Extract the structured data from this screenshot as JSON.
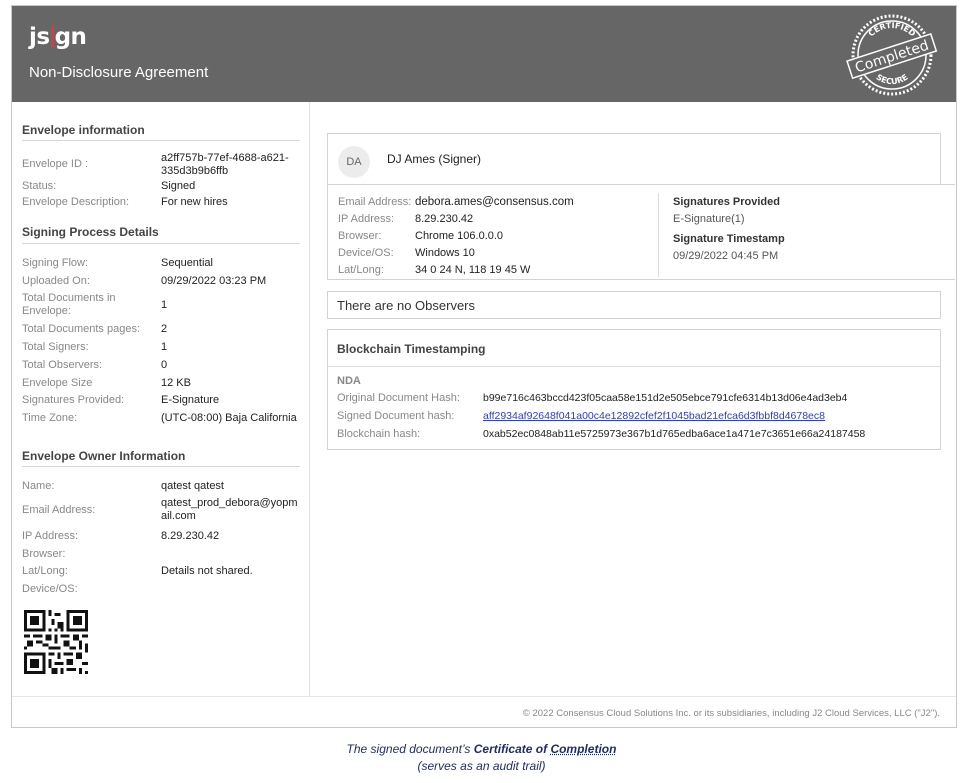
{
  "header": {
    "logo_left": "js",
    "logo_right": "gn",
    "document_title": "Non-Disclosure Agreement",
    "seal_top": "CERTIFIED",
    "seal_middle": "Completed",
    "seal_bottom": "SECURE"
  },
  "envelope_info": {
    "title": "Envelope information",
    "rows": [
      {
        "label": "Envelope ID :",
        "value": "a2ff757b-77ef-4688-a621-335d3b9b6ffb"
      },
      {
        "label": "Status:",
        "value": "Signed"
      },
      {
        "label": "Envelope Description:",
        "value": "For new hires"
      }
    ]
  },
  "signing_process": {
    "title": "Signing Process Details",
    "rows": [
      {
        "label": "Signing Flow:",
        "value": "Sequential"
      },
      {
        "label": "Uploaded On:",
        "value": "09/29/2022 03:23 PM"
      },
      {
        "label": "Total Documents in Envelope:",
        "value": "1"
      },
      {
        "label": "Total Documents pages:",
        "value": "2"
      },
      {
        "label": "Total Signers:",
        "value": "1"
      },
      {
        "label": "Total Observers:",
        "value": "0"
      },
      {
        "label": "Envelope Size",
        "value": "12 KB"
      },
      {
        "label": "Signatures Provided:",
        "value": "E-Signature"
      },
      {
        "label": "Time Zone:",
        "value": "(UTC-08:00) Baja California"
      }
    ]
  },
  "owner_info": {
    "title": "Envelope Owner Information",
    "rows": [
      {
        "label": "Name:",
        "value": "qatest qatest"
      },
      {
        "label": "Email Address:",
        "value": "qatest_prod_debora@yopmail.com"
      },
      {
        "label": "IP Address:",
        "value": "8.29.230.42"
      },
      {
        "label": "Browser:",
        "value": ""
      },
      {
        "label": "Lat/Long:",
        "value": "Details not shared."
      },
      {
        "label": "Device/OS:",
        "value": ""
      }
    ]
  },
  "signer": {
    "initials": "DA",
    "name": "DJ Ames (Signer)",
    "details": [
      {
        "label": "Email Address:",
        "value": "debora.ames@consensus.com"
      },
      {
        "label": "IP Address:",
        "value": "8.29.230.42"
      },
      {
        "label": "Browser:",
        "value": "Chrome 106.0.0.0"
      },
      {
        "label": "Device/OS:",
        "value": "Windows 10"
      },
      {
        "label": "Lat/Long:",
        "value": "34 0 24 N, 118 19 45 W"
      }
    ],
    "signatures_title": "Signatures Provided",
    "signatures_value": "E-Signature(1)",
    "timestamp_title": "Signature Timestamp",
    "timestamp_value": "09/29/2022 04:45 PM"
  },
  "observers": {
    "text": "There are no Observers"
  },
  "blockchain": {
    "title": "Blockchain Timestamping",
    "document_name": "NDA",
    "rows": [
      {
        "label": "Original Document Hash:",
        "value": "b99e716c463bccd423f05caa58e151d2e505ebce791cfe6314b13d06e4ad3eb4"
      },
      {
        "label": "Signed Document hash:",
        "value": "aff2934af92648f041a00c4e12892cfef2f1045bad21efca6d3fbbf8d4678ec8"
      },
      {
        "label": "Blockchain hash:",
        "value": "0xab52ec0848ab11e5725973e367b1d765edba6ace1a471e7c3651e66a24187458"
      }
    ]
  },
  "footer": {
    "copyright": "© 2022 Consensus Cloud Solutions Inc. or its subsidiaries, including J2 Cloud Services, LLC (\"J2\")."
  },
  "caption": {
    "prefix": "The signed document’s ",
    "bold_a": "Certificate of ",
    "bold_b": "Completion",
    "line2": "(serves as an audit trail)"
  },
  "colors": {
    "header_bg": "#666666",
    "logo_accent": "#e8353b",
    "link": "#2b3bd8",
    "caption": "#1f2d6b"
  }
}
